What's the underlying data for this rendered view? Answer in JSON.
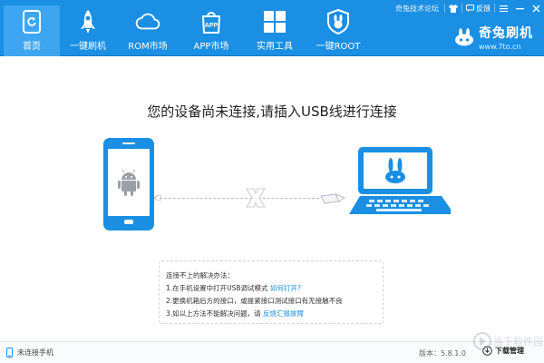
{
  "nav": {
    "items": [
      {
        "label": "首页",
        "icon": "phone-refresh-icon",
        "active": true
      },
      {
        "label": "一键刷机",
        "icon": "rocket-icon"
      },
      {
        "label": "ROM市场",
        "icon": "cloud-icon"
      },
      {
        "label": "APP市场",
        "icon": "app-bag-icon"
      },
      {
        "label": "实用工具",
        "icon": "grid-icon"
      },
      {
        "label": "一键ROOT",
        "icon": "rabbit-shield-icon"
      }
    ]
  },
  "window_controls": {
    "forum": "奇兔技术论坛",
    "feedback": "反馈"
  },
  "brand": {
    "name": "奇兔刷机",
    "url": "www.7to.cn"
  },
  "main": {
    "headline": "您的设备尚未连接,请插入USB线进行连接"
  },
  "tips": {
    "title": "连接不上的解决办法：",
    "line1": "1.在手机设置中打开USB调试模式",
    "line1_link": "如何打开?",
    "line2": "2.更换机箱后方的接口，或提紧接口测试接口有无接触不良",
    "line3": "3.如以上方法不能解决问题，请",
    "line3_link": "反馈汇报故障"
  },
  "status": {
    "device": "未连接手机",
    "version": "版本：5.8.1.0",
    "download": "下载管理"
  },
  "watermark": {
    "text": "当下软件园"
  },
  "colors": {
    "primary": "#1a8fe3",
    "active_tab": "#3ea6f1",
    "link": "#1a8fe3"
  }
}
